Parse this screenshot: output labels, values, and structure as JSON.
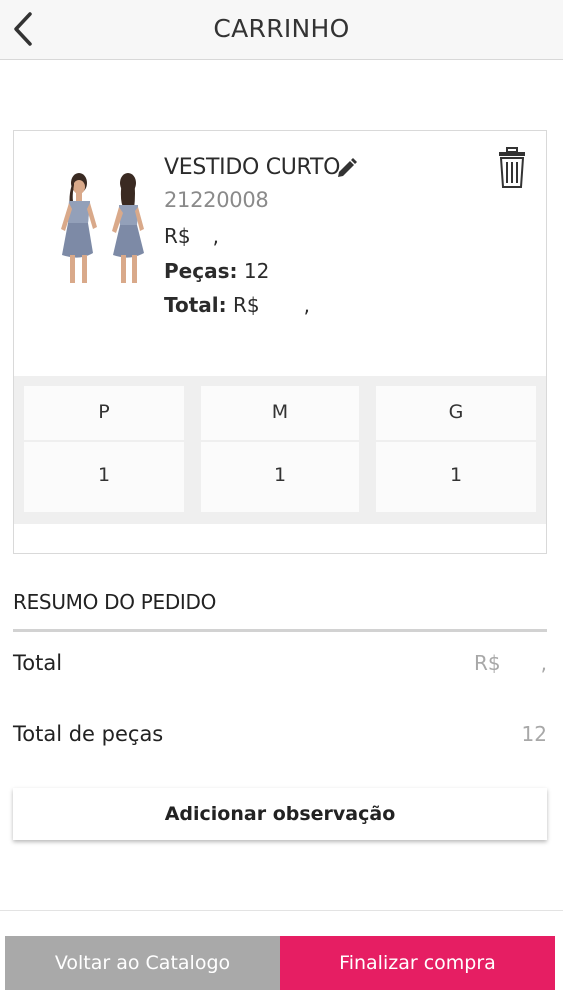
{
  "header": {
    "title": "CARRINHO",
    "back_icon": "chevron-left-icon"
  },
  "item": {
    "name": "VESTIDO CURTO",
    "code": "21220008",
    "price_prefix": "R$",
    "price_sep": ",",
    "pieces_label": "Peças:",
    "pieces_value": "12",
    "total_label": "Total:",
    "total_prefix": "R$",
    "total_sep": ",",
    "edit_icon": "pencil-icon",
    "delete_icon": "trash-icon",
    "image": "dress-product-image",
    "sizes": [
      {
        "size": "P",
        "qty": "1"
      },
      {
        "size": "M",
        "qty": "1"
      },
      {
        "size": "G",
        "qty": "1"
      }
    ]
  },
  "summary": {
    "title": "RESUMO DO PEDIDO",
    "total_label": "Total",
    "total_prefix": "R$",
    "total_sep": ",",
    "pieces_label": "Total de peças",
    "pieces_value": "12"
  },
  "note_button": "Adicionar observação",
  "footer": {
    "back_label": "Voltar ao Catalogo",
    "finish_label": "Finalizar compra"
  },
  "colors": {
    "accent": "#e61e63",
    "secondary": "#a9a9a9"
  }
}
